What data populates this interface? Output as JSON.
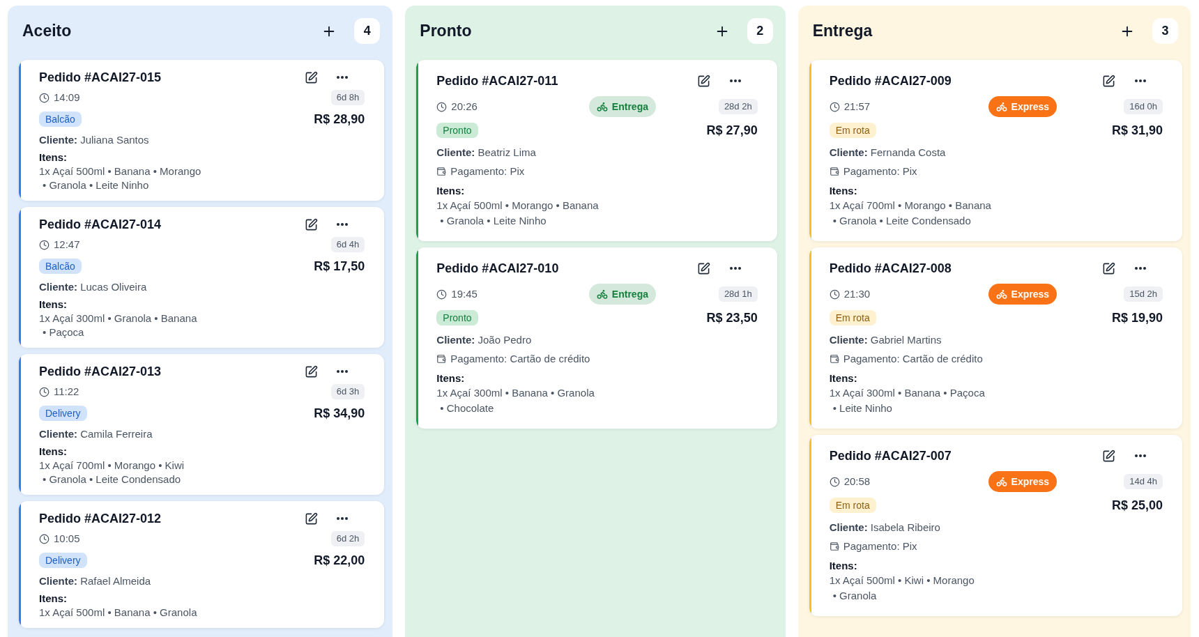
{
  "columns": [
    {
      "title": "Aceito",
      "count": "4",
      "color": "#2f80ed",
      "cards": [
        {
          "title": "Pedido #ACAI27-015",
          "time": "14:09",
          "age": "6d 8h",
          "tag": {
            "label": "Balcão",
            "color": "#1d5fc4"
          },
          "price": "R$ 28,90",
          "client": "**Cliente:** Juliana Santos",
          "items_label": "Itens:",
          "items": [
            "1x Açaí 500ml • Banana • Morango",
            "• Granola • Leite Ninho"
          ]
        },
        {
          "title": "Pedido #ACAI27-014",
          "time": "12:47",
          "age": "6d 4h",
          "tag": {
            "label": "Balcão",
            "color": "#1d5fc4"
          },
          "price": "R$ 17,50",
          "client": "**Cliente:** Lucas Oliveira",
          "items_label": "Itens:",
          "items": [
            "1x Açaí 300ml • Granola • Banana",
            "• Paçoca"
          ]
        },
        {
          "title": "Pedido #ACAI27-013",
          "time": "11:22",
          "age": "6d 3h",
          "tag": {
            "label": "Delivery",
            "color": "#1d5fc4"
          },
          "price": "R$ 34,90",
          "client": "**Cliente:** Camila Ferreira",
          "items_label": "Itens:",
          "items": [
            "1x Açaí 700ml • Morango • Kiwi",
            "• Granola • Leite Condensado"
          ]
        },
        {
          "title": "Pedido #ACAI27-012",
          "time": "10:05",
          "age": "6d 2h",
          "tag": {
            "label": "Delivery",
            "color": "#1d5fc4"
          },
          "price": "R$ 22,00",
          "client": "**Cliente:** Rafael Almeida",
          "items_label": "Itens:",
          "items": [
            "1x Açaí 500ml • Banana • Granola"
          ]
        }
      ]
    },
    {
      "title": "Pronto",
      "count": "2",
      "color": "#16a34a",
      "cards": [
        {
          "title": "Pedido #ACAI27-011",
          "time": "20:26",
          "delivery": {
            "label": "Entrega",
            "kind": "soft",
            "color": "#15803d"
          },
          "age": "28d 2h",
          "tag": {
            "label": "Pronto",
            "color": "#15803d"
          },
          "price": "R$ 27,90",
          "client": "**Cliente:** Beatriz Lima",
          "payment": "Pagamento: Pix",
          "items_label": "Itens:",
          "items": [
            "1x Açaí 500ml • Morango • Banana",
            "• Granola • Leite Ninho"
          ]
        },
        {
          "title": "Pedido #ACAI27-010",
          "time": "19:45",
          "delivery": {
            "label": "Entrega",
            "kind": "soft",
            "color": "#15803d"
          },
          "age": "28d 1h",
          "tag": {
            "label": "Pronto",
            "color": "#15803d"
          },
          "price": "R$ 23,50",
          "client": "**Cliente:** João Pedro",
          "payment": "Pagamento: Cartão de crédito",
          "items_label": "Itens:",
          "items": [
            "1x Açaí 300ml • Banana • Granola",
            "• Chocolate"
          ]
        }
      ]
    },
    {
      "title": "Entrega",
      "count": "3",
      "color": "#fbbf24",
      "cards": [
        {
          "title": "Pedido #ACAI27-009",
          "time": "21:57",
          "delivery": {
            "label": "Express",
            "kind": "solid",
            "color": "#f97316"
          },
          "age": "16d 0h",
          "tag": {
            "label": "Em rota",
            "color": "#8f600f"
          },
          "price": "R$ 31,90",
          "client": "**Cliente:** Fernanda Costa",
          "payment": "Pagamento: Pix",
          "items_label": "Itens:",
          "items": [
            "1x Açaí 700ml • Morango • Banana",
            "• Granola • Leite Condensado"
          ]
        },
        {
          "title": "Pedido #ACAI27-008",
          "time": "21:30",
          "delivery": {
            "label": "Express",
            "kind": "solid",
            "color": "#f97316"
          },
          "age": "15d 2h",
          "tag": {
            "label": "Em rota",
            "color": "#8f600f"
          },
          "price": "R$ 19,90",
          "client": "**Cliente:** Gabriel Martins",
          "payment": "Pagamento: Cartão de crédito",
          "items_label": "Itens:",
          "items": [
            "1x Açaí 300ml • Banana • Paçoca",
            "• Leite Ninho"
          ]
        },
        {
          "title": "Pedido #ACAI27-007",
          "time": "20:58",
          "delivery": {
            "label": "Express",
            "kind": "solid",
            "color": "#f97316"
          },
          "age": "14d 4h",
          "tag": {
            "label": "Em rota",
            "color": "#8f600f"
          },
          "price": "R$ 25,00",
          "client": "**Cliente:** Isabela Ribeiro",
          "payment": "Pagamento: Pix",
          "items_label": "Itens:",
          "items": [
            "1x Açaí 500ml • Kiwi • Morango",
            "• Granola"
          ]
        }
      ]
    }
  ]
}
